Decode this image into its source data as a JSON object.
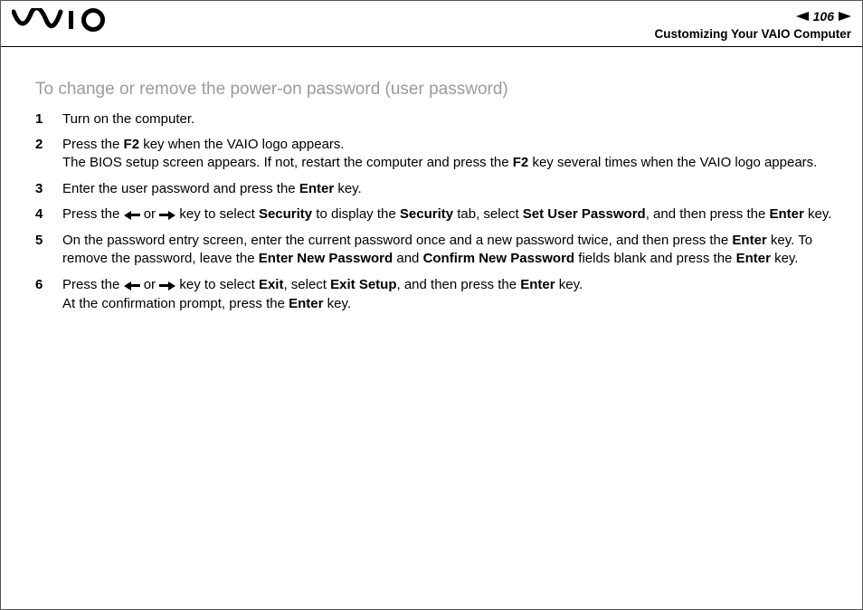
{
  "header": {
    "page_number": "106",
    "section": "Customizing Your VAIO Computer"
  },
  "heading": "To change or remove the power-on password (user password)",
  "steps": {
    "s1": {
      "t1": "Turn on the computer."
    },
    "s2": {
      "t1": "Press the ",
      "b1": "F2",
      "t2": " key when the VAIO logo appears.",
      "t3": "The BIOS setup screen appears. If not, restart the computer and press the ",
      "b2": "F2",
      "t4": " key several times when the VAIO logo appears."
    },
    "s3": {
      "t1": "Enter the user password and press the ",
      "b1": "Enter",
      "t2": " key."
    },
    "s4": {
      "t1": "Press the ",
      "t2": " or ",
      "t3": " key to select ",
      "b1": "Security",
      "t4": " to display the ",
      "b2": "Security",
      "t5": " tab, select ",
      "b3": "Set User Password",
      "t6": ", and then press the ",
      "b4": "Enter",
      "t7": " key."
    },
    "s5": {
      "t1": "On the password entry screen, enter the current password once and a new password twice, and then press the ",
      "b1": "Enter",
      "t2": " key. To remove the password, leave the ",
      "b2": "Enter New Password",
      "t3": " and ",
      "b3": "Confirm New Password",
      "t4": " fields blank and press the ",
      "b4": "Enter",
      "t5": " key."
    },
    "s6": {
      "t1": "Press the ",
      "t2": " or ",
      "t3": " key to select ",
      "b1": "Exit",
      "t4": ", select ",
      "b2": "Exit Setup",
      "t5": ", and then press the ",
      "b3": "Enter",
      "t6": " key.",
      "t7": "At the confirmation prompt, press the ",
      "b4": "Enter",
      "t8": " key."
    }
  }
}
